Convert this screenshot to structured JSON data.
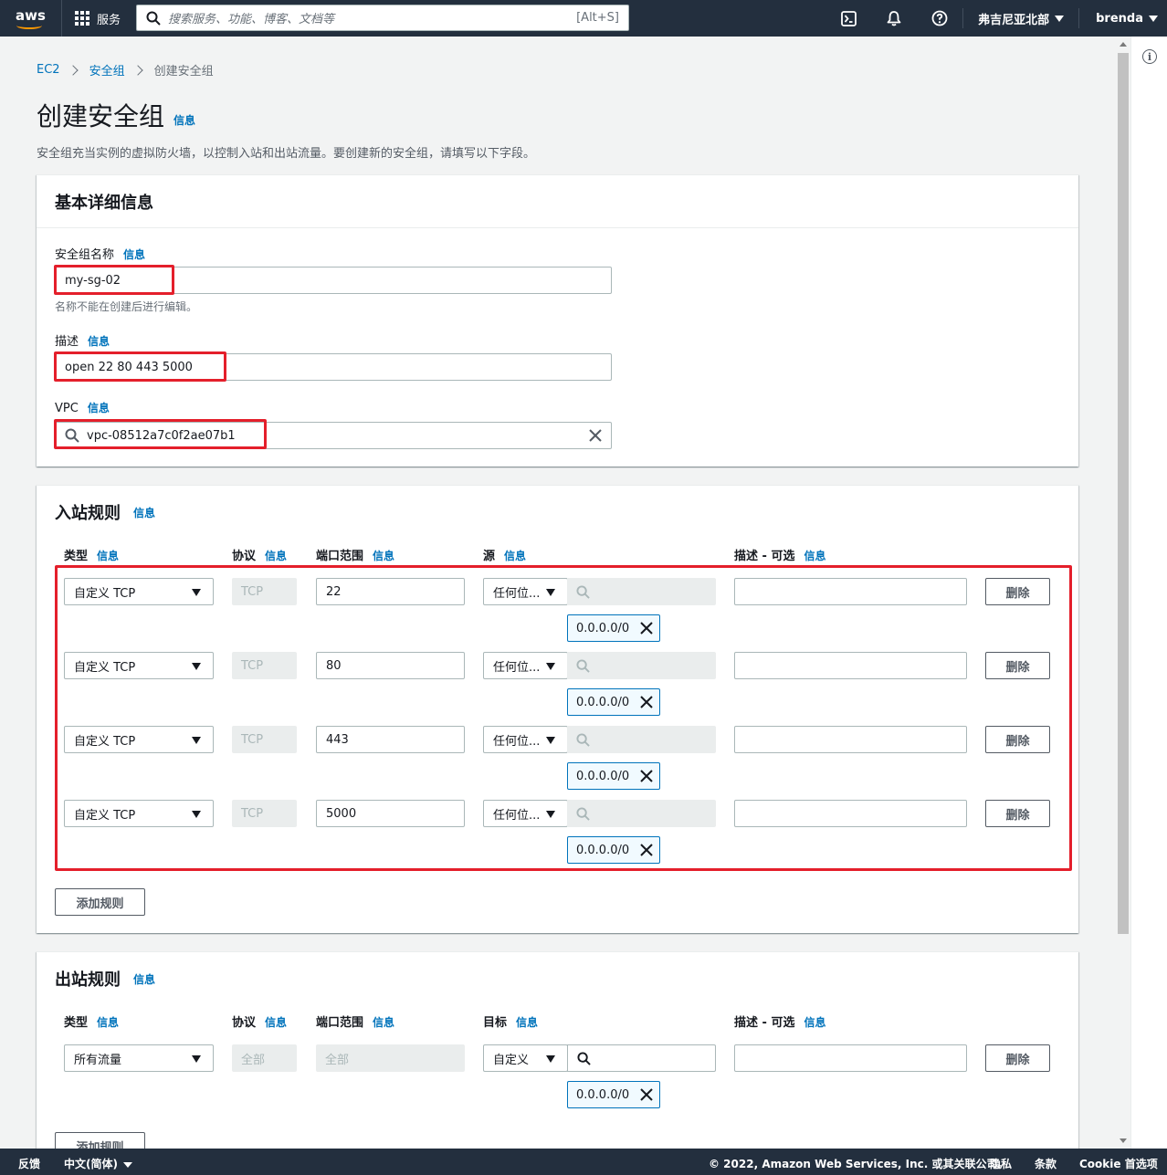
{
  "nav": {
    "logo": "aws",
    "services": "服务",
    "search_placeholder": "搜索服务、功能、博客、文档等",
    "search_shortcut": "[Alt+S]",
    "icons": [
      "cloudshell-icon",
      "bell-icon",
      "help-icon"
    ],
    "region": "弗吉尼亚北部",
    "user": "brenda"
  },
  "breadcrumb": [
    "EC2",
    "安全组",
    "创建安全组"
  ],
  "page": {
    "title": "创建安全组",
    "info": "信息",
    "description": "安全组充当实例的虚拟防火墙，以控制入站和出站流量。要创建新的安全组，请填写以下字段。"
  },
  "basic": {
    "heading": "基本详细信息",
    "name_label": "安全组名称",
    "name_value": "my-sg-02",
    "name_hint": "名称不能在创建后进行编辑。",
    "desc_label": "描述",
    "desc_value": "open 22 80 443 5000",
    "vpc_label": "VPC",
    "vpc_value": "vpc-08512a7c0f2ae07b1",
    "info": "信息"
  },
  "inbound": {
    "heading": "入站规则",
    "info": "信息",
    "columns": {
      "type": "类型",
      "protocol": "协议",
      "port": "端口范围",
      "source": "源",
      "desc": "描述 - 可选"
    },
    "rules": [
      {
        "type": "自定义 TCP",
        "protocol": "TCP",
        "port": "22",
        "source": "任何位...",
        "cidr": "0.0.0.0/0"
      },
      {
        "type": "自定义 TCP",
        "protocol": "TCP",
        "port": "80",
        "source": "任何位...",
        "cidr": "0.0.0.0/0"
      },
      {
        "type": "自定义 TCP",
        "protocol": "TCP",
        "port": "443",
        "source": "任何位...",
        "cidr": "0.0.0.0/0"
      },
      {
        "type": "自定义 TCP",
        "protocol": "TCP",
        "port": "5000",
        "source": "任何位...",
        "cidr": "0.0.0.0/0"
      }
    ],
    "delete": "删除",
    "add_rule": "添加规则"
  },
  "outbound": {
    "heading": "出站规则",
    "info": "信息",
    "columns": {
      "type": "类型",
      "protocol": "协议",
      "port": "端口范围",
      "dest": "目标",
      "desc": "描述 - 可选"
    },
    "rule": {
      "type": "所有流量",
      "protocol": "全部",
      "port": "全部",
      "dest": "自定义",
      "cidr": "0.0.0.0/0"
    },
    "delete": "删除",
    "add_rule": "添加规则"
  },
  "footer": {
    "feedback": "反馈",
    "language": "中文(简体)",
    "copyright": "© 2022, Amazon Web Services, Inc. 或其关联公司。",
    "privacy": "隐私",
    "terms": "条款",
    "cookie": "Cookie 首选项"
  },
  "colors": {
    "nav_bg": "#232f3e",
    "link": "#0073bb",
    "highlight": "#e41f2b",
    "accent": "#ff9900"
  }
}
